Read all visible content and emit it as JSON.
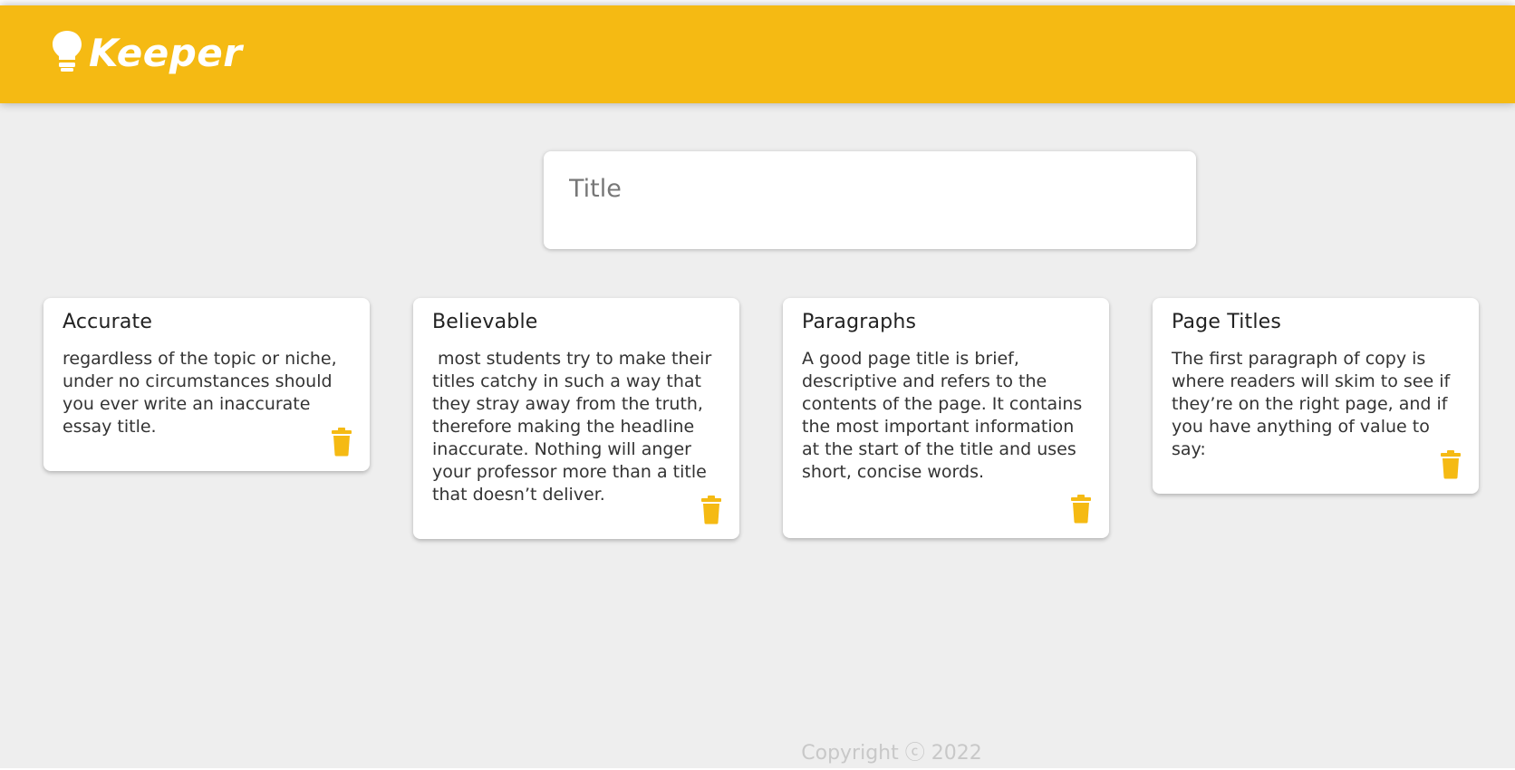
{
  "app": {
    "name": "Keeper",
    "logo_icon": "lightbulb-icon",
    "accent_color": "#f5ba13",
    "background_color": "#eeeeee"
  },
  "create_note": {
    "title_placeholder": "Title",
    "title_value": ""
  },
  "notes": [
    {
      "title": "Accurate",
      "content": "regardless of the topic or niche, under no circumstances should you ever write an inaccurate essay title.",
      "delete_icon": "trash-icon"
    },
    {
      "title": "Believable",
      "content": " most students try to make their titles catchy in such a way that they stray away from the truth, therefore making the headline inaccurate. Nothing will anger your professor more than a title that doesn’t deliver.",
      "delete_icon": "trash-icon"
    },
    {
      "title": "Paragraphs",
      "content": "A good page title is brief, descriptive and refers to the contents of the page. It contains the most important information at the start of the title and uses short, concise words.",
      "delete_icon": "trash-icon"
    },
    {
      "title": "Page Titles",
      "content": "The first paragraph of copy is where readers will skim to see if they’re on the right page, and if you have anything of value to say:",
      "delete_icon": "trash-icon"
    }
  ],
  "footer": {
    "copyright": "Copyright ⓒ 2022"
  }
}
